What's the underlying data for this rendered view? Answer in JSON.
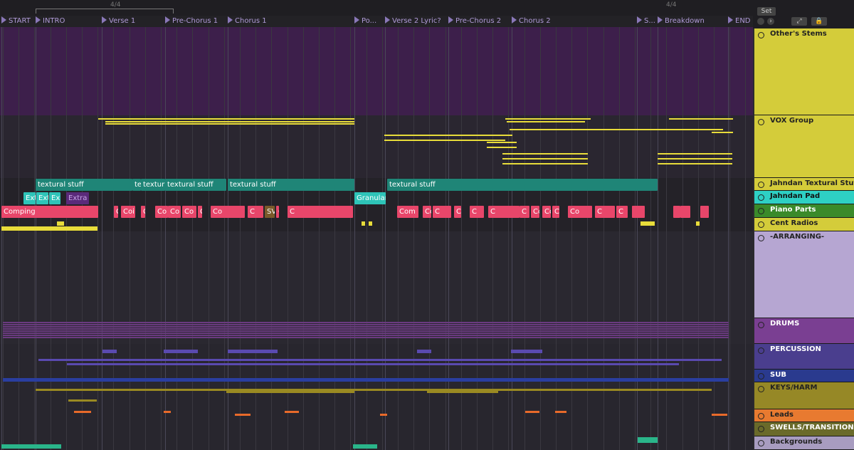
{
  "topbar": {
    "sig_left": "4/4",
    "sig_right": "4/4",
    "set_label": "Set"
  },
  "locators": [
    "START",
    "INTRO",
    "Verse 1",
    "Pre-Chorus 1",
    "Chorus 1",
    "Po...",
    "Verse 2 Lyric?",
    "Pre-Chorus 2",
    "Chorus 2",
    "S...",
    "Breakdown",
    "END"
  ],
  "clips": {
    "textural": [
      "textural stuff",
      "te",
      "textur",
      "textural stuff",
      "textural stuff",
      "textural stuff"
    ],
    "jahndan_pad": [
      "Ext",
      "Ext",
      "Ex",
      "Extra",
      "Granular"
    ],
    "piano": [
      "Comping",
      "C",
      "Coi",
      "C",
      "Co",
      "Co",
      "Co",
      "Comping",
      "Co",
      "C",
      "SVS solo",
      "Com",
      "C",
      "Com",
      "Co",
      "C",
      "Comping",
      "C",
      "C",
      "C",
      "Compi",
      "Com",
      "Ca",
      "Co",
      "C",
      "C"
    ]
  },
  "tracks": [
    {
      "name": "Other's Stems",
      "color": "#d4cc3a",
      "text": "#222"
    },
    {
      "name": "VOX Group",
      "color": "#d4cc3a",
      "text": "#222"
    },
    {
      "name": "Jahndan Textural Stuf",
      "color": "#d4cc3a",
      "text": "#222"
    },
    {
      "name": "Jahndan Pad",
      "color": "#2ed0c4",
      "text": "#111"
    },
    {
      "name": "Piano Parts",
      "color": "#3a8a2a",
      "text": "#fff"
    },
    {
      "name": "Cent Radios",
      "color": "#d4cc3a",
      "text": "#222"
    },
    {
      "name": "-ARRANGING-",
      "color": "#b6a6d2",
      "text": "#222"
    },
    {
      "name": "DRUMS",
      "color": "#7a3f92",
      "text": "#fff"
    },
    {
      "name": "PERCUSSION",
      "color": "#4a3e8e",
      "text": "#fff"
    },
    {
      "name": "SUB",
      "color": "#2a3a8e",
      "text": "#fff"
    },
    {
      "name": "KEYS/HARM",
      "color": "#968826",
      "text": "#222"
    },
    {
      "name": "Leads",
      "color": "#e87a30",
      "text": "#222"
    },
    {
      "name": "SWELLS/TRANSITIONS",
      "color": "#6a6a2a",
      "text": "#fff"
    },
    {
      "name": "Backgrounds",
      "color": "#a89cc0",
      "text": "#222"
    }
  ],
  "colors": {
    "yellow": "#e8dc3a",
    "teal": "#1f8b7e",
    "pink": "#e8466a",
    "purple_bg": "#3e1f4e",
    "drums": "#6a3a80",
    "perc": "#5a4ab0",
    "sub": "#2a3ea0",
    "keys": "#9a8a22",
    "leads": "#e86a2a"
  }
}
